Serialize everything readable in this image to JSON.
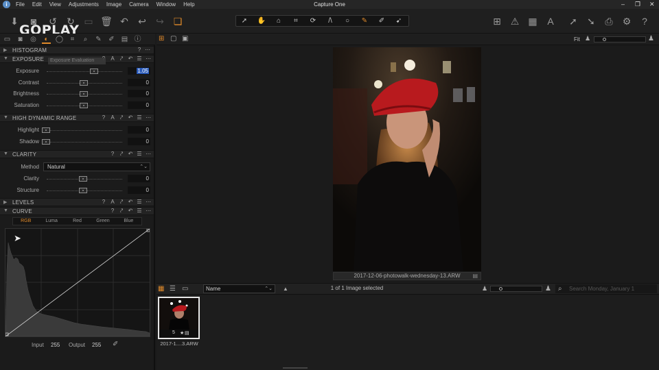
{
  "window": {
    "title": "Capture One",
    "menus": [
      "File",
      "Edit",
      "View",
      "Adjustments",
      "Image",
      "Camera",
      "Window",
      "Help"
    ]
  },
  "watermark": "GOPLAY",
  "colors": {
    "accent": "#e08a2a",
    "selection": "#2a5ab8"
  },
  "viewer": {
    "zoom_label": "Fit"
  },
  "panels": {
    "histogram": {
      "title": "HISTOGRAM"
    },
    "exposure": {
      "title": "EXPOSURE",
      "tooltip": "Exposure Evaluation",
      "sliders": [
        {
          "label": "Exposure",
          "value": "1.05"
        },
        {
          "label": "Contrast",
          "value": "0"
        },
        {
          "label": "Brightness",
          "value": "0"
        },
        {
          "label": "Saturation",
          "value": "0"
        }
      ]
    },
    "hdr": {
      "title": "HIGH DYNAMIC RANGE",
      "sliders": [
        {
          "label": "Highlight",
          "value": "0"
        },
        {
          "label": "Shadow",
          "value": "0"
        }
      ]
    },
    "clarity": {
      "title": "CLARITY",
      "method_label": "Method",
      "method_value": "Natural",
      "sliders": [
        {
          "label": "Clarity",
          "value": "0"
        },
        {
          "label": "Structure",
          "value": "0"
        }
      ]
    },
    "levels": {
      "title": "LEVELS"
    },
    "curve": {
      "title": "CURVE",
      "tabs": [
        "RGB",
        "Luma",
        "Red",
        "Green",
        "Blue"
      ],
      "input_label": "Input",
      "input_value": "255",
      "output_label": "Output",
      "output_value": "255"
    }
  },
  "photo": {
    "caption": "2017-12-06-photowalk-wednesday-13.ARW"
  },
  "browser": {
    "sort_value": "Name",
    "selection_status": "1 of 1 Image selected",
    "search_placeholder": "Search Monday, January 1",
    "thumbnails": [
      {
        "name": "2017-1....3.ARW",
        "rating": "5",
        "stars": "★"
      }
    ]
  }
}
